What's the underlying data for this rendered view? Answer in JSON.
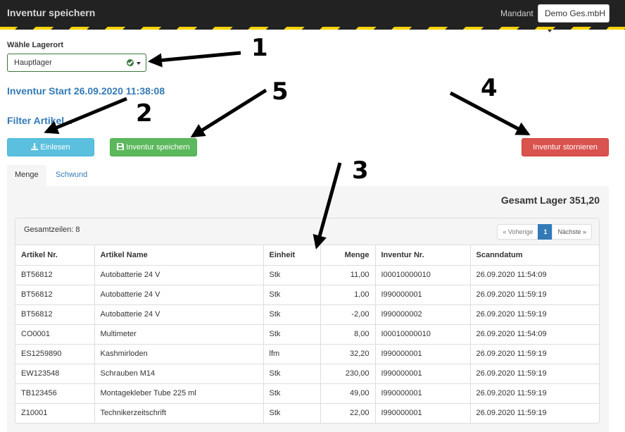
{
  "header": {
    "title": "Inventur speichern",
    "mandant_label": "Mandant",
    "mandant_value": "Demo Ges.mbH"
  },
  "lager": {
    "label": "Wähle Lagerort",
    "selected": "Hauptlager"
  },
  "inventur_start": "Inventur Start 26.09.2020 11:38:08",
  "filter_title": "Filter Artikel...",
  "buttons": {
    "einlesen": "Einlesen",
    "speichern": "Inventur speichern",
    "stornieren": "Inventur stornieren"
  },
  "tabs": [
    {
      "label": "Menge",
      "active": true
    },
    {
      "label": "Schwund",
      "active": false
    }
  ],
  "gesamt_lager": "Gesamt Lager 351,20",
  "table": {
    "row_count": "Gesamtzeilen: 8",
    "pager": {
      "prev": "« Voherige",
      "current": "1",
      "next": "Nächste »"
    },
    "columns": [
      "Artikel Nr.",
      "Artikel Name",
      "Einheit",
      "Menge",
      "Inventur Nr.",
      "Scanndatum"
    ],
    "rows": [
      [
        "BT56812",
        "Autobatterie 24 V",
        "Stk",
        "11,00",
        "I00010000010",
        "26.09.2020 11:54:09"
      ],
      [
        "BT56812",
        "Autobatterie 24 V",
        "Stk",
        "1,00",
        "I990000001",
        "26.09.2020 11:59:19"
      ],
      [
        "BT56812",
        "Autobatterie 24 V",
        "Stk",
        "-2,00",
        "I990000002",
        "26.09.2020 11:59:19"
      ],
      [
        "CO0001",
        "Multimeter",
        "Stk",
        "8,00",
        "I00010000010",
        "26.09.2020 11:54:09"
      ],
      [
        "ES1259890",
        "Kashmirloden",
        "lfm",
        "32,20",
        "I990000001",
        "26.09.2020 11:59:19"
      ],
      [
        "EW123548",
        "Schrauben M14",
        "Stk",
        "230,00",
        "I990000001",
        "26.09.2020 11:59:19"
      ],
      [
        "TB123456",
        "Montagekleber Tube 225 ml",
        "Stk",
        "49,00",
        "I990000001",
        "26.09.2020 11:59:19"
      ],
      [
        "Z10001",
        "Technikerzeitschrift",
        "Stk",
        "22,00",
        "I990000001",
        "26.09.2020 11:59:19"
      ]
    ]
  },
  "annotations": [
    "1",
    "2",
    "3",
    "4",
    "5"
  ],
  "colors": {
    "accent": "#337ab7",
    "info": "#5bc0de",
    "success": "#5cb85c",
    "danger": "#d9534f"
  }
}
